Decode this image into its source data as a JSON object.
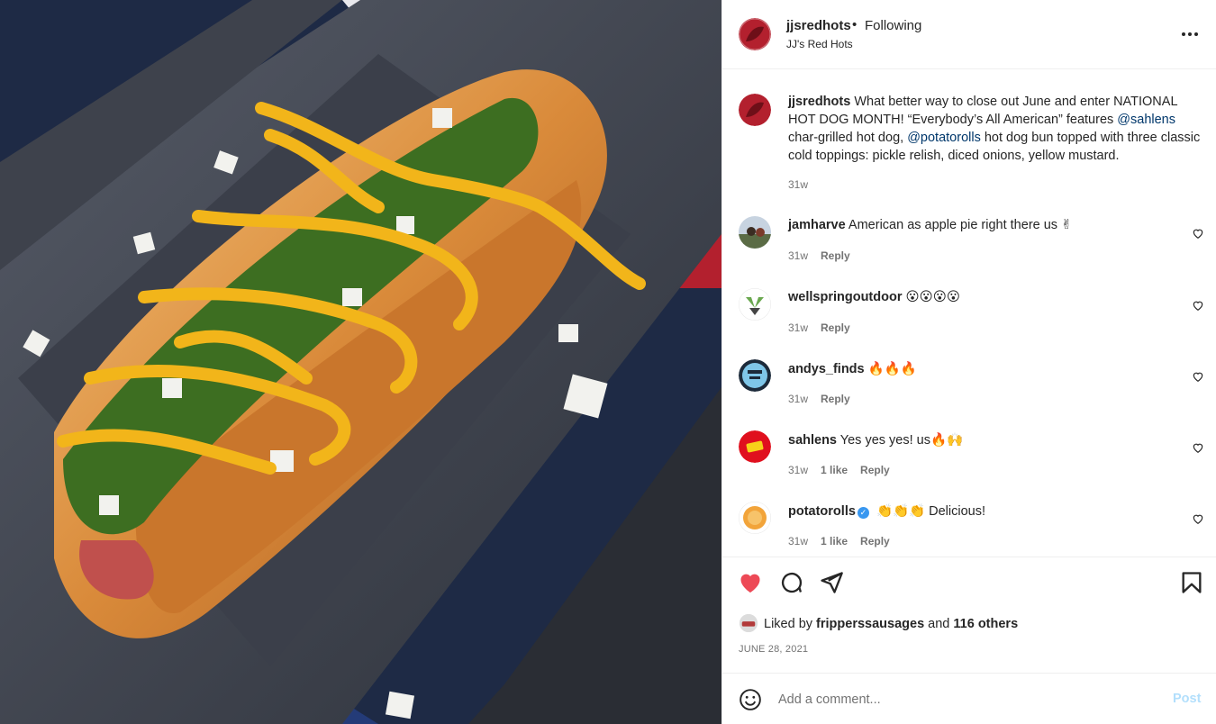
{
  "header": {
    "username": "jjsredhots",
    "separator": "•",
    "follow_state": "Following",
    "subtitle": "JJ's Red Hots",
    "more_icon": "more-horizontal-icon"
  },
  "caption": {
    "username": "jjsredhots",
    "text_1": "What better way to close out June and enter NATIONAL HOT DOG MONTH! “Everybody’s All American” features",
    "mention_1": "@sahlens",
    "text_2": "char-grilled hot dog,",
    "mention_2": "@potatorolls",
    "text_3": "hot dog bun topped with three classic cold toppings: pickle relish, diced onions, yellow mustard.",
    "time": "31w"
  },
  "comments": [
    {
      "username": "jamharve",
      "text": "American as apple pie right there us ✌",
      "time": "31w",
      "likes": "",
      "reply": "Reply"
    },
    {
      "username": "wellspringoutdoor",
      "text": "😮😮😮😮",
      "time": "31w",
      "likes": "",
      "reply": "Reply"
    },
    {
      "username": "andys_finds",
      "text": "🔥🔥🔥",
      "time": "31w",
      "likes": "",
      "reply": "Reply"
    },
    {
      "username": "sahlens",
      "text": "Yes yes yes! us🔥🙌",
      "time": "31w",
      "likes": "1 like",
      "reply": "Reply"
    },
    {
      "username": "potatorolls",
      "verified": "✓",
      "text": "👏👏👏 Delicious!",
      "time": "31w",
      "likes": "1 like",
      "reply": "Reply"
    }
  ],
  "actions": {
    "like_icon": "heart-filled-icon",
    "comment_icon": "comment-icon",
    "share_icon": "share-icon",
    "save_icon": "bookmark-icon",
    "liked_by_prefix": "Liked by",
    "liked_by_user": "fripperssausages",
    "liked_by_and": "and",
    "liked_by_others": "116 others",
    "date": "JUNE 28, 2021"
  },
  "add_comment": {
    "placeholder": "Add a comment...",
    "post_label": "Post",
    "emoji_icon": "smile-icon"
  },
  "colors": {
    "like_red": "#ed4956",
    "mention_blue": "#00376b",
    "post_disabled": "#b2dffc",
    "verified_blue": "#3897f0"
  }
}
